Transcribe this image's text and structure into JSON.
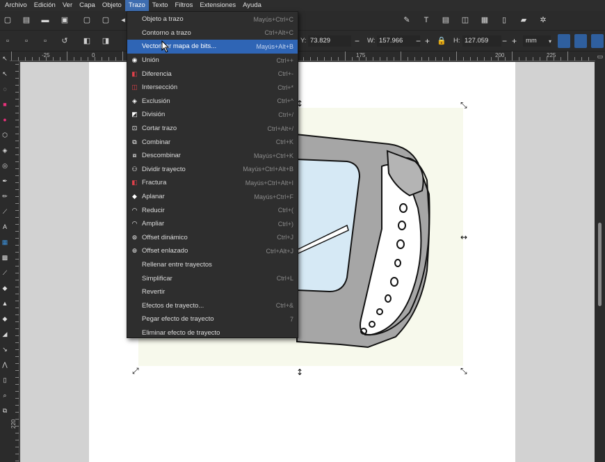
{
  "menubar": {
    "items": [
      "Archivo",
      "Edición",
      "Ver",
      "Capa",
      "Objeto",
      "Trazo",
      "Texto",
      "Filtros",
      "Extensiones",
      "Ayuda"
    ],
    "active_index": 5
  },
  "path_menu": {
    "items": [
      {
        "label": "Objeto a trazo",
        "shortcut": "Mayús+Ctrl+C",
        "icon": ""
      },
      {
        "label": "Contorno a trazo",
        "shortcut": "Ctrl+Alt+C",
        "icon": ""
      },
      {
        "label": "Vectorizar mapa de bits...",
        "shortcut": "Mayús+Alt+B",
        "icon": "",
        "highlighted": true
      },
      {
        "label": "Unión",
        "shortcut": "Ctrl++",
        "icon": "union-icon"
      },
      {
        "label": "Diferencia",
        "shortcut": "Ctrl+-",
        "icon": "difference-icon"
      },
      {
        "label": "Intersección",
        "shortcut": "Ctrl+*",
        "icon": "intersection-icon"
      },
      {
        "label": "Exclusión",
        "shortcut": "Ctrl+^",
        "icon": "exclusion-icon"
      },
      {
        "label": "División",
        "shortcut": "Ctrl+/",
        "icon": "division-icon"
      },
      {
        "label": "Cortar trazo",
        "shortcut": "Ctrl+Alt+/",
        "icon": "cut-path-icon"
      },
      {
        "label": "Combinar",
        "shortcut": "Ctrl+K",
        "icon": "combine-icon"
      },
      {
        "label": "Descombinar",
        "shortcut": "Mayús+Ctrl+K",
        "icon": "break-apart-icon"
      },
      {
        "label": "Dividir trayecto",
        "shortcut": "Mayús+Ctrl+Alt+B",
        "icon": "split-path-icon"
      },
      {
        "label": "Fractura",
        "shortcut": "Mayús+Ctrl+Alt+I",
        "icon": "fracture-icon"
      },
      {
        "label": "Aplanar",
        "shortcut": "Mayús+Ctrl+F",
        "icon": "flatten-icon"
      },
      {
        "label": "Reducir",
        "shortcut": "Ctrl+(",
        "icon": "inset-icon"
      },
      {
        "label": "Ampliar",
        "shortcut": "Ctrl+)",
        "icon": "outset-icon"
      },
      {
        "label": "Offset dinámico",
        "shortcut": "Ctrl+J",
        "icon": "dynamic-offset-icon"
      },
      {
        "label": "Offset enlazado",
        "shortcut": "Ctrl+Alt+J",
        "icon": "linked-offset-icon"
      },
      {
        "label": "Rellenar entre trayectos",
        "shortcut": "",
        "icon": ""
      },
      {
        "label": "Simplificar",
        "shortcut": "Ctrl+L",
        "icon": ""
      },
      {
        "label": "Revertir",
        "shortcut": "",
        "icon": ""
      },
      {
        "label": "Efectos de trayecto...",
        "shortcut": "Ctrl+&",
        "icon": ""
      },
      {
        "label": "Pegar efecto de trayecto",
        "shortcut": "7",
        "icon": ""
      },
      {
        "label": "Eliminar efecto de trayecto",
        "shortcut": "",
        "icon": ""
      }
    ]
  },
  "controls": {
    "y_label": "Y:",
    "y_value": "73.829",
    "w_label": "W:",
    "w_value": "157.966",
    "h_label": "H:",
    "h_value": "127.059",
    "unit": "mm",
    "minus": "−",
    "plus": "+"
  },
  "ruler": {
    "top_labels": [
      "-25",
      "0",
      "175",
      "200",
      "225"
    ],
    "left_labels": [
      "220"
    ]
  },
  "colors": {
    "accent": "#2f65b5",
    "canvas": "#d2d2d2",
    "selection_bg": "#f7f9ec",
    "band_gray": "#a8a8a8",
    "screen_blue": "#d6e9f5"
  }
}
